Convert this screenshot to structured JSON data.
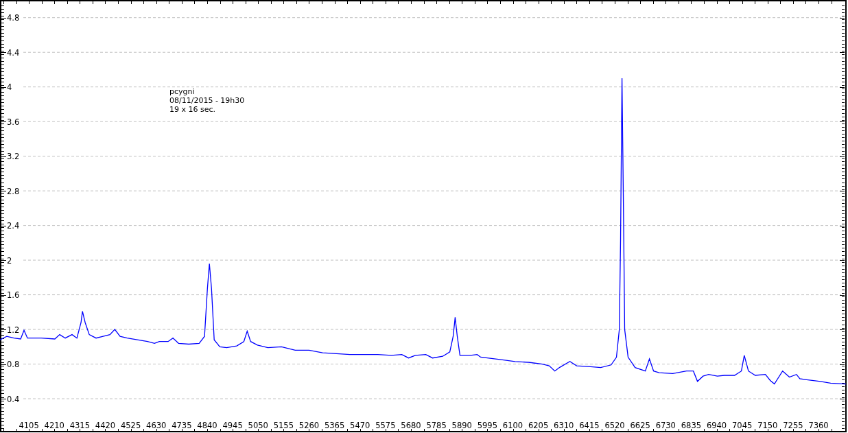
{
  "chart": {
    "chart_data": {
      "type": "line",
      "x": [
        3986,
        4014,
        4043,
        4071,
        4085,
        4099,
        4156,
        4212,
        4232,
        4255,
        4283,
        4303,
        4320,
        4326,
        4337,
        4354,
        4382,
        4411,
        4439,
        4459,
        4481,
        4510,
        4552,
        4594,
        4623,
        4643,
        4679,
        4699,
        4722,
        4764,
        4807,
        4829,
        4841,
        4849,
        4858,
        4869,
        4892,
        4920,
        4962,
        4991,
        5005,
        5019,
        5047,
        5090,
        5146,
        5203,
        5260,
        5316,
        5373,
        5429,
        5486,
        5543,
        5599,
        5642,
        5670,
        5698,
        5741,
        5769,
        5811,
        5840,
        5854,
        5862,
        5871,
        5882,
        5925,
        5953,
        5967,
        5995,
        6052,
        6109,
        6165,
        6222,
        6250,
        6273,
        6292,
        6335,
        6363,
        6420,
        6462,
        6505,
        6527,
        6539,
        6544,
        6550,
        6556,
        6561,
        6575,
        6604,
        6646,
        6663,
        6680,
        6703,
        6759,
        6816,
        6844,
        6861,
        6884,
        6907,
        6943,
        6972,
        7014,
        7042,
        7054,
        7071,
        7099,
        7141,
        7161,
        7178,
        7212,
        7240,
        7269,
        7283,
        7311,
        7368,
        7410,
        7473
      ],
      "series": [
        {
          "name": "pcygni",
          "color": "#0000ff",
          "values": [
            1.08,
            1.12,
            1.1,
            1.09,
            1.19,
            1.1,
            1.1,
            1.09,
            1.14,
            1.1,
            1.14,
            1.1,
            1.28,
            1.41,
            1.28,
            1.14,
            1.1,
            1.12,
            1.14,
            1.2,
            1.12,
            1.1,
            1.08,
            1.06,
            1.04,
            1.06,
            1.06,
            1.1,
            1.04,
            1.03,
            1.04,
            1.12,
            1.67,
            1.96,
            1.67,
            1.08,
            1.0,
            0.99,
            1.01,
            1.06,
            1.18,
            1.06,
            1.02,
            0.99,
            1.0,
            0.96,
            0.96,
            0.93,
            0.92,
            0.91,
            0.91,
            0.91,
            0.9,
            0.91,
            0.87,
            0.9,
            0.91,
            0.87,
            0.89,
            0.94,
            1.12,
            1.34,
            1.12,
            0.9,
            0.9,
            0.91,
            0.88,
            0.87,
            0.85,
            0.83,
            0.82,
            0.8,
            0.78,
            0.72,
            0.76,
            0.83,
            0.78,
            0.77,
            0.76,
            0.79,
            0.88,
            1.2,
            2.23,
            4.1,
            2.62,
            1.2,
            0.88,
            0.76,
            0.72,
            0.86,
            0.72,
            0.7,
            0.69,
            0.72,
            0.72,
            0.6,
            0.66,
            0.68,
            0.66,
            0.67,
            0.67,
            0.72,
            0.9,
            0.72,
            0.67,
            0.68,
            0.61,
            0.57,
            0.72,
            0.65,
            0.68,
            0.63,
            0.62,
            0.6,
            0.58,
            0.57
          ]
        }
      ],
      "xlim": [
        3986,
        7473
      ],
      "ylim": [
        0.02,
        4.98
      ],
      "xticks": [
        4105,
        4210,
        4315,
        4420,
        4525,
        4630,
        4735,
        4840,
        4945,
        5050,
        5155,
        5260,
        5365,
        5470,
        5575,
        5680,
        5785,
        5890,
        5995,
        6100,
        6205,
        6310,
        6415,
        6520,
        6625,
        6730,
        6835,
        6940,
        7045,
        7150,
        7255,
        7360
      ],
      "yticks": [
        0.4,
        0.8,
        1.2,
        1.6,
        2,
        2.4,
        2.8,
        3.2,
        3.6,
        4,
        4.4,
        4.8
      ],
      "grid": true,
      "annotations": [
        "08/11/2015 - 19h30",
        "19 x 16 sec."
      ]
    }
  }
}
